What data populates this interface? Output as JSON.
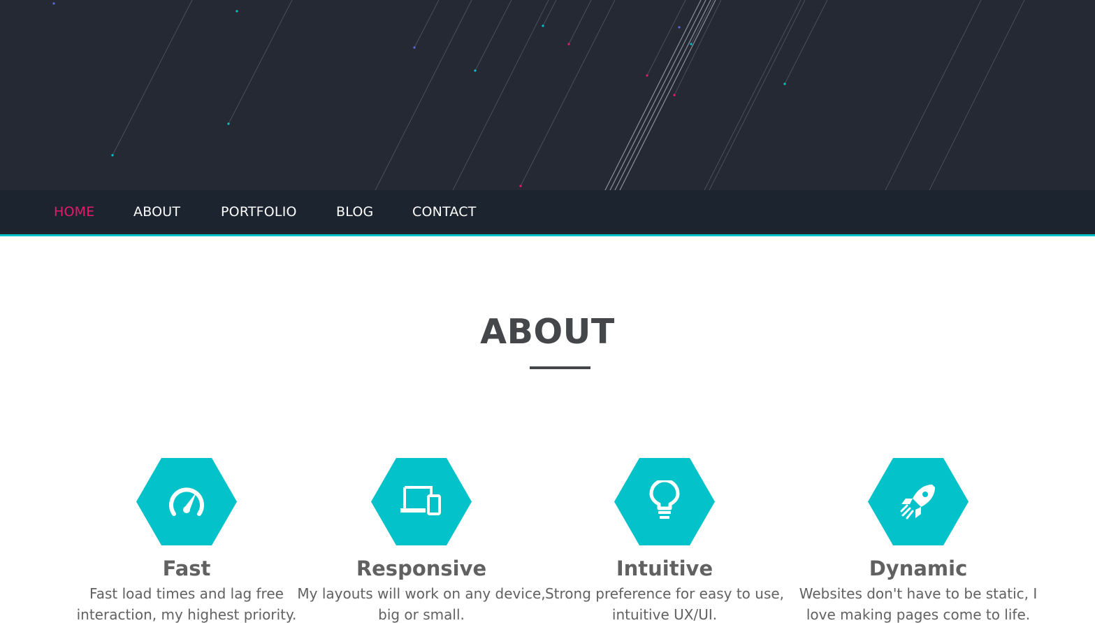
{
  "nav": {
    "items": [
      {
        "label": "HOME",
        "active": true
      },
      {
        "label": "ABOUT",
        "active": false
      },
      {
        "label": "PORTFOLIO",
        "active": false
      },
      {
        "label": "BLOG",
        "active": false
      },
      {
        "label": "CONTACT",
        "active": false
      }
    ]
  },
  "about": {
    "title": "ABOUT",
    "features": [
      {
        "icon": "speedometer-icon",
        "title": "Fast",
        "text": "Fast load times and lag free interaction, my highest priority."
      },
      {
        "icon": "devices-icon",
        "title": "Responsive",
        "text": "My layouts will work on any device, big or small."
      },
      {
        "icon": "lightbulb-icon",
        "title": "Intuitive",
        "text": "Strong preference for easy to use, intuitive UX/UI."
      },
      {
        "icon": "rocket-icon",
        "title": "Dynamic",
        "text": "Websites don't have to be static, I love making pages come to life."
      }
    ]
  },
  "colors": {
    "hero_bg": "#252934",
    "nav_bg": "#1b242f",
    "accent_teal": "#04c2c9",
    "accent_pink": "#e31b6d",
    "heading_text": "#444649",
    "body_text": "#616161"
  }
}
